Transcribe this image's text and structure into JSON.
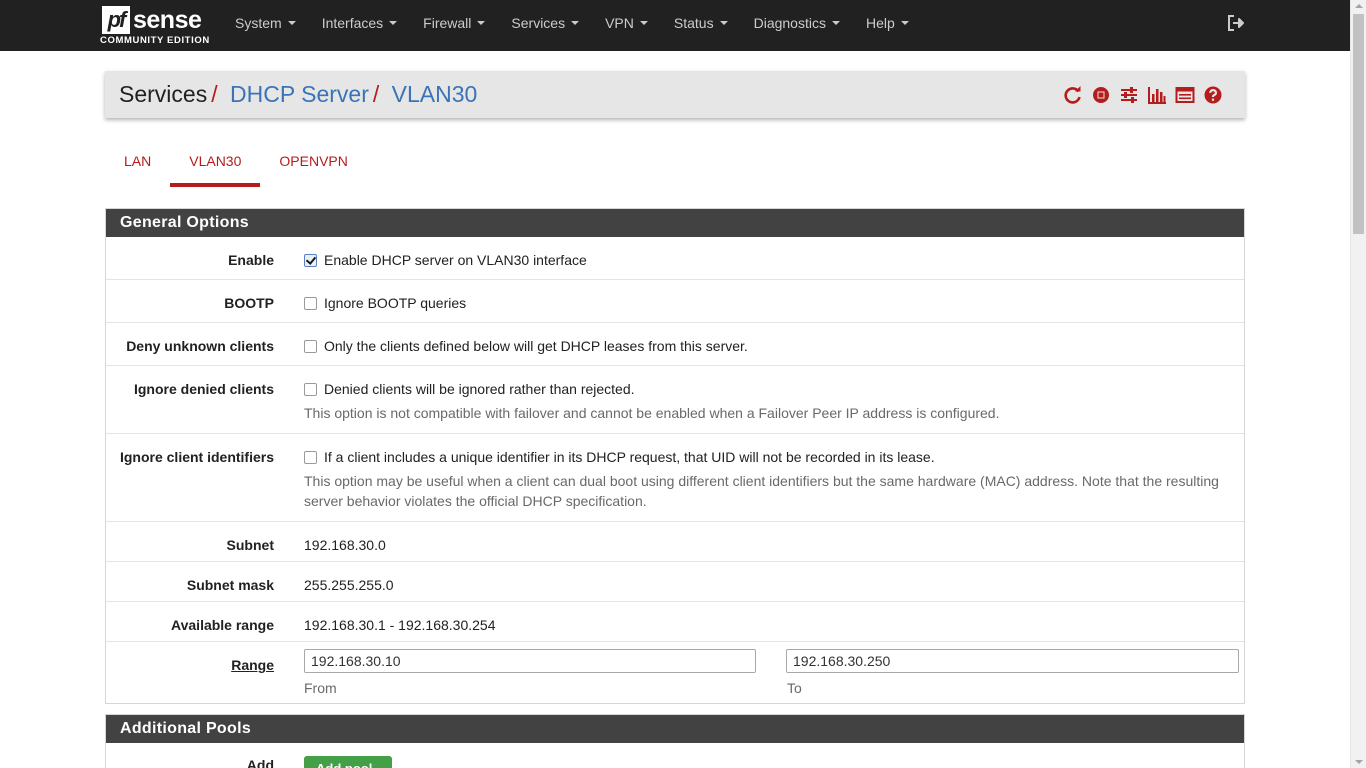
{
  "brand": {
    "name": "sense",
    "mark": "pf",
    "edition": "COMMUNITY EDITION"
  },
  "nav": {
    "items": [
      {
        "label": "System"
      },
      {
        "label": "Interfaces"
      },
      {
        "label": "Firewall"
      },
      {
        "label": "Services"
      },
      {
        "label": "VPN"
      },
      {
        "label": "Status"
      },
      {
        "label": "Diagnostics"
      },
      {
        "label": "Help"
      }
    ],
    "logout_icon": "logout-icon"
  },
  "breadcrumb": {
    "root": "Services",
    "section": "DHCP Server",
    "page": "VLAN30",
    "separator": "/",
    "icons": [
      "restart-icon",
      "stop-icon",
      "settings-sliders-icon",
      "chart-icon",
      "log-icon",
      "help-icon"
    ],
    "accent_color": "#b71c1c"
  },
  "tabs": [
    {
      "label": "LAN",
      "active": false
    },
    {
      "label": "VLAN30",
      "active": true
    },
    {
      "label": "OPENVPN",
      "active": false
    }
  ],
  "general": {
    "title": "General Options",
    "enable": {
      "label": "Enable",
      "text": "Enable DHCP server on VLAN30 interface",
      "checked": true
    },
    "bootp": {
      "label": "BOOTP",
      "text": "Ignore BOOTP queries",
      "checked": false
    },
    "deny_unknown": {
      "label": "Deny unknown clients",
      "text": "Only the clients defined below will get DHCP leases from this server.",
      "checked": false
    },
    "ignore_denied": {
      "label": "Ignore denied clients",
      "text": "Denied clients will be ignored rather than rejected.",
      "help": "This option is not compatible with failover and cannot be enabled when a Failover Peer IP address is configured.",
      "checked": false
    },
    "ignore_client_ids": {
      "label": "Ignore client identifiers",
      "text": "If a client includes a unique identifier in its DHCP request, that UID will not be recorded in its lease.",
      "help1": "This option may be useful when a client can dual boot using different client identifiers but the same hardware (MAC) address. Note that the resulting",
      "help2": "server behavior violates the official DHCP specification.",
      "checked": false
    },
    "subnet": {
      "label": "Subnet",
      "value": "192.168.30.0"
    },
    "subnet_mask": {
      "label": "Subnet mask",
      "value": "255.255.255.0"
    },
    "available_range": {
      "label": "Available range",
      "value": "192.168.30.1 - 192.168.30.254"
    },
    "range": {
      "label": "Range",
      "from_value": "192.168.30.10",
      "from_label": "From",
      "to_value": "192.168.30.250",
      "to_label": "To"
    }
  },
  "pools": {
    "title": "Additional Pools",
    "add_label": "Add",
    "add_button": "Add pool"
  }
}
